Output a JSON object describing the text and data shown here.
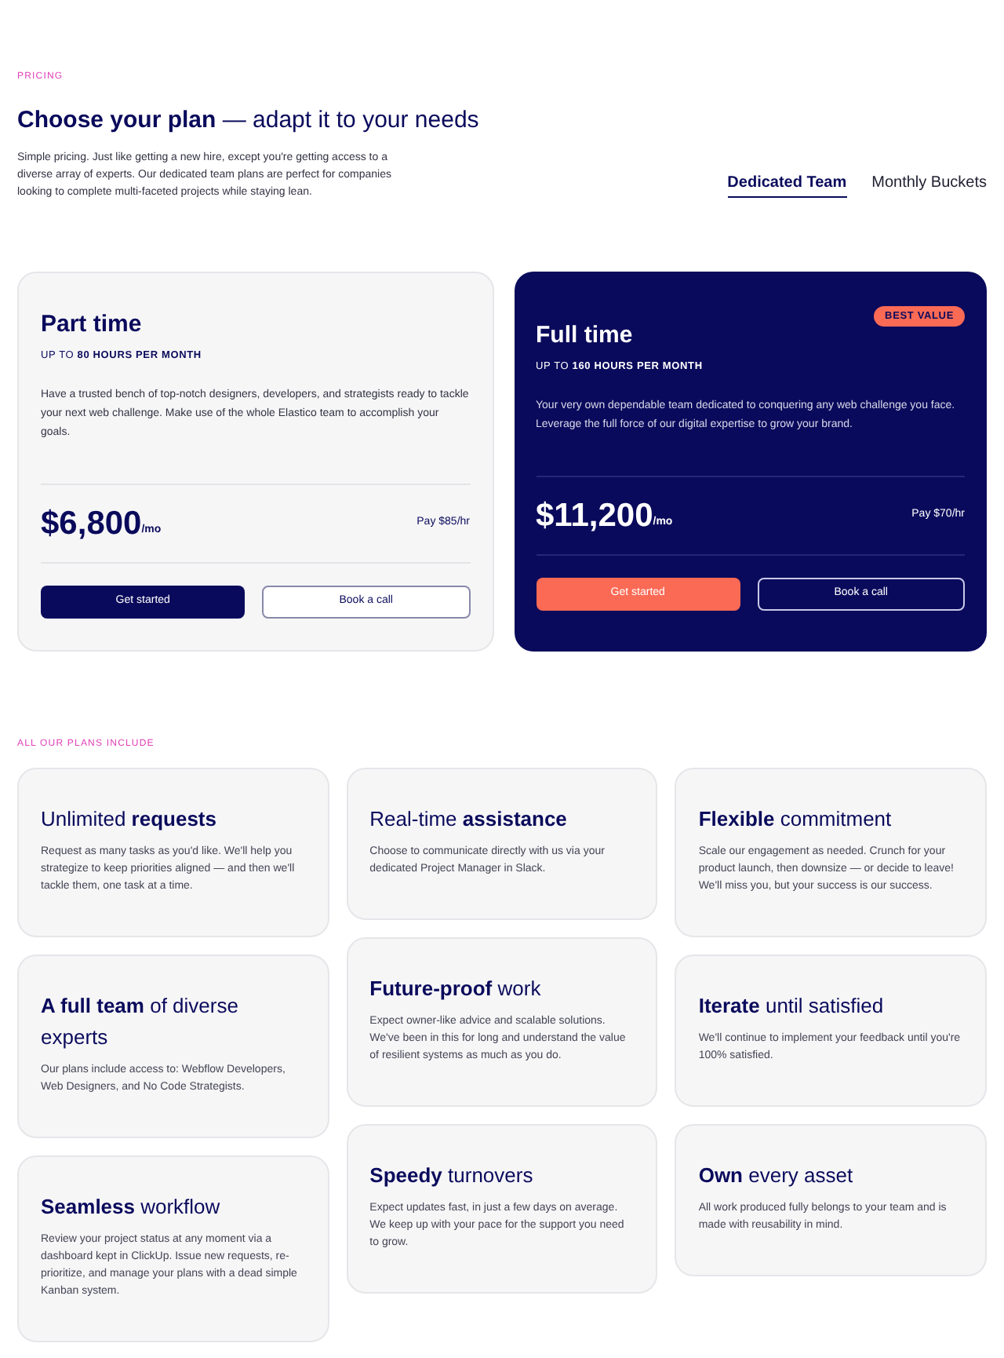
{
  "eyebrow": "PRICING",
  "headline": "**Choose your plan** — adapt it to your needs",
  "intro": "Simple pricing. Just like getting a new hire, except you're getting access to a diverse array of experts. Our dedicated team plans are perfect for companies looking to complete multi-faceted projects while staying lean.",
  "tabs": [
    {
      "label": "Dedicated Team",
      "selected": true
    },
    {
      "label": "Monthly Buckets",
      "selected": false
    }
  ],
  "plans": [
    {
      "name": "Part time",
      "featured": false,
      "hours": "UP TO **80 HOURS PER MONTH**",
      "description": "Have a trusted bench of top-notch designers, developers, and strategists ready to tackle your next web challenge. Make use of the whole Elastico team to accomplish your goals.",
      "price": "$6,800",
      "period": "/mo",
      "rate": "Pay $85/hr",
      "primary": "Get started",
      "secondary": "Book a call"
    },
    {
      "name": "Full time",
      "featured": true,
      "badge": "BEST VALUE",
      "hours": "UP TO **160 HOURS PER MONTH**",
      "description": "Your very own dependable team dedicated to conquering any web challenge you face. Leverage the full force of our digital expertise to grow your brand.",
      "price": "$11,200",
      "period": "/mo",
      "rate": "Pay $70/hr",
      "primary": "Get started",
      "secondary": "Book a call"
    }
  ],
  "includes_label": "ALL OUR PLANS INCLUDE",
  "features": [
    {
      "title": "Unlimited **requests**",
      "text": "Request as many tasks as you'd like. We'll help you strategize to keep priorities aligned — and then we'll tackle them, one task at a time."
    },
    {
      "title": "Real-time **assistance**",
      "text": "Choose to communicate directly with us via your dedicated Project Manager in Slack."
    },
    {
      "title": "**Flexible** commitment",
      "text": "Scale our engagement as needed. Crunch for your product launch, then downsize — or decide to leave! We'll miss you, but your success is our success."
    },
    {
      "title": "**A full team** of diverse experts",
      "text": "Our plans include access to: Webflow Developers, Web Designers, and No Code Strategists."
    },
    {
      "title": "**Future-proof** work",
      "text": "Expect owner-like advice and scalable solutions. We've been in this for long and understand the value of resilient systems as much as you do."
    },
    {
      "title": "**Iterate** until satisfied",
      "text": "We'll continue to implement your feedback until you're 100% satisfied."
    },
    {
      "title": "**Seamless** workflow",
      "text": "Review your project status at any moment via a dashboard kept in ClickUp. Issue new requests, re-prioritize, and manage your plans with a dead simple Kanban system."
    },
    {
      "title": "**Speedy** turnovers",
      "text": "Expect updates fast, in just a few days on average. We keep up with your pace for the support you need to grow."
    },
    {
      "title": "**Own** every asset",
      "text": "All work produced fully belongs to your team and is made with reusability in mind."
    }
  ]
}
